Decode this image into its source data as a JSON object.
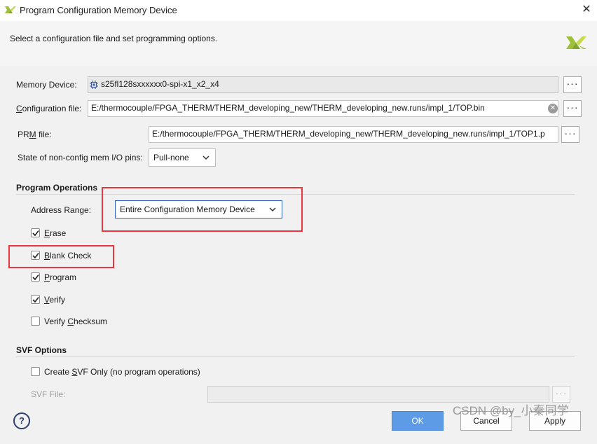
{
  "window": {
    "title": "Program Configuration Memory Device",
    "close_glyph": "✕"
  },
  "header": {
    "subtitle": "Select a configuration file and set programming options."
  },
  "memory_device": {
    "label": "Memory Device:",
    "value": "s25fl128sxxxxxx0-spi-x1_x2_x4",
    "browse": "···"
  },
  "configuration_file": {
    "label_prefix": "C",
    "label_rest": "onfiguration file:",
    "value": "E:/thermocouple/FPGA_THERM/THERM_developing_new/THERM_developing_new.runs/impl_1/TOP.bin",
    "clear_glyph": "✕",
    "browse": "···"
  },
  "prm_file": {
    "label_a": "PR",
    "label_u": "M",
    "label_b": " file:",
    "value": "E:/thermocouple/FPGA_THERM/THERM_developing_new/THERM_developing_new.runs/impl_1/TOP1.p",
    "browse": "···"
  },
  "nonconfig_pins": {
    "label": "State of non-config mem I/O pins:",
    "selected": "Pull-none"
  },
  "program_operations": {
    "title": "Program Operations",
    "address_range_label": "Address Range:",
    "address_range_selected": "Entire Configuration Memory Device",
    "options": [
      {
        "u": "E",
        "rest": "rase",
        "checked": true
      },
      {
        "u": "B",
        "rest": "lank Check",
        "checked": true
      },
      {
        "u": "P",
        "rest": "rogram",
        "checked": true
      },
      {
        "u": "V",
        "rest": "erify",
        "checked": true
      },
      {
        "pre": "Verify ",
        "u": "C",
        "rest": "hecksum",
        "checked": false
      }
    ]
  },
  "svf_options": {
    "title": "SVF Options",
    "create_pre": "Create ",
    "create_u": "S",
    "create_rest": "VF Only (no program operations)",
    "create_checked": false,
    "svf_file_label": "SVF File:",
    "svf_file_value": "",
    "browse": "···"
  },
  "footer": {
    "help": "?",
    "ok": "OK",
    "cancel": "Cancel",
    "apply": "Apply"
  },
  "watermark": "CSDN @by_小秦同学",
  "colors": {
    "annotation_red": "#e8383d",
    "primary_button": "#5d9be6",
    "focus_border": "#2f5fbf",
    "logo_green": "#9fc13a"
  }
}
